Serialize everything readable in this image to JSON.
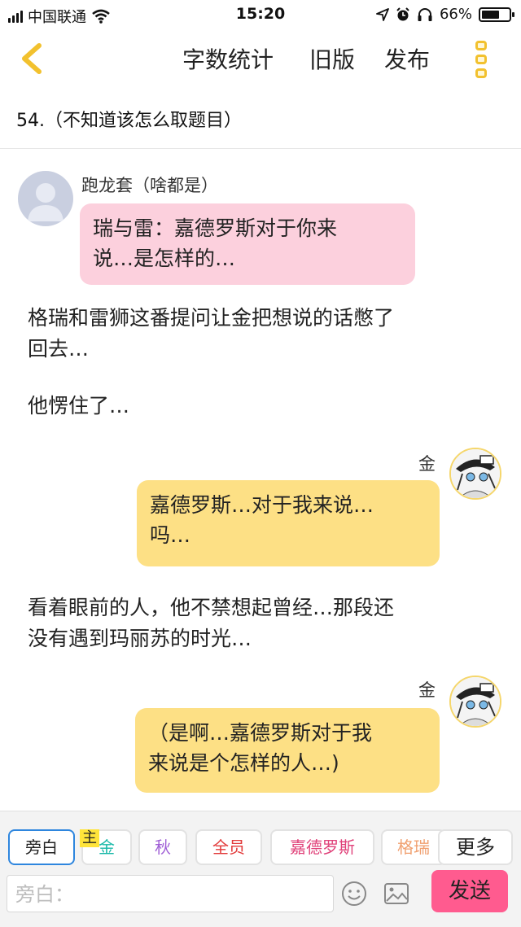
{
  "status_bar": {
    "carrier": "中国联通",
    "time": "15:20",
    "battery_percent": 66,
    "battery_label": "66%",
    "icons": [
      "signal-icon",
      "wifi-icon",
      "location-icon",
      "alarm-icon",
      "headphones-icon",
      "battery-icon"
    ]
  },
  "nav": {
    "back_icon": "chevron-left-icon",
    "word_count": "字数统计",
    "old_version": "旧版",
    "publish": "发布",
    "more_icon": "more-vertical-icon"
  },
  "story": {
    "title": "54.（不知道该怎么取题目）"
  },
  "messages": [
    {
      "type": "dialogue",
      "speaker": "跑龙套（啥都是）",
      "side": "left",
      "color": "pink",
      "lines": [
        "瑞与雷：嘉德罗斯对于你来",
        "说…是怎样的…"
      ]
    },
    {
      "type": "narration",
      "lines": [
        "格瑞和雷狮这番提问让金把想说的话憋了",
        "回去…"
      ]
    },
    {
      "type": "narration",
      "lines": [
        "他愣住了…"
      ]
    },
    {
      "type": "dialogue",
      "speaker": "金",
      "side": "right",
      "color": "yellow",
      "lines": [
        "嘉德罗斯…对于我来说…",
        "吗…"
      ]
    },
    {
      "type": "narration",
      "lines": [
        "看着眼前的人，他不禁想起曾经…那段还",
        "没有遇到玛丽苏的时光…"
      ]
    },
    {
      "type": "dialogue",
      "speaker": "金",
      "side": "right",
      "color": "yellow",
      "lines": [
        "（是啊…嘉德罗斯对于我",
        "来说是个怎样的人…)"
      ]
    }
  ],
  "composer": {
    "roles": [
      {
        "label": "旁白",
        "color": "#222222",
        "active": true
      },
      {
        "label": "金",
        "color": "#18b8a8",
        "tag": "主"
      },
      {
        "label": "秋",
        "color": "#a05fd6"
      },
      {
        "label": "全员",
        "color": "#e23a3a"
      },
      {
        "label": "嘉德罗斯",
        "color": "#e0427a"
      },
      {
        "label": "格瑞",
        "color": "#f0a070"
      }
    ],
    "more_label": "更多",
    "placeholder": "旁白：",
    "emoji_icon": "emoji-icon",
    "image_icon": "image-icon",
    "send_label": "发送",
    "accent": "#ff5b8f"
  }
}
